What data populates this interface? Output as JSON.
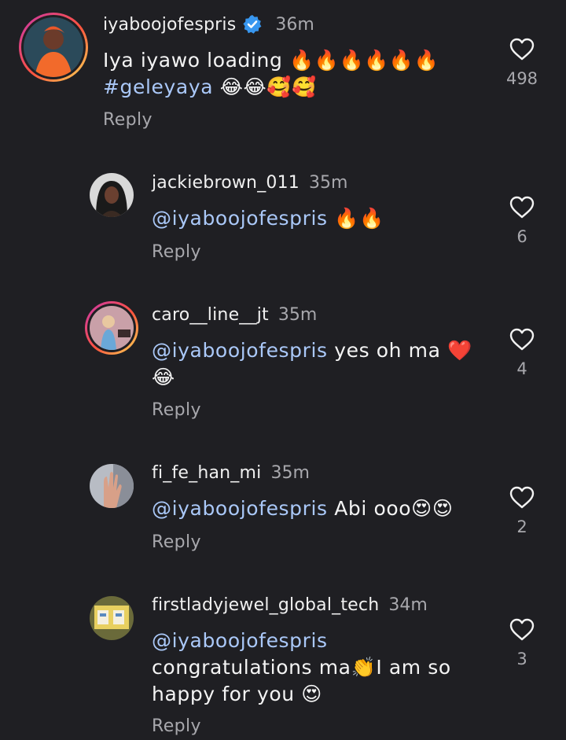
{
  "comments": [
    {
      "username": "iyaboojofespris",
      "verified": true,
      "time": "36m",
      "text_line1": "Iya iyawo loading 🔥🔥🔥🔥🔥🔥",
      "hashtag": "#geleyaya",
      "text_line2_emoji": "😂😂🥰🥰",
      "reply": "Reply",
      "likes": "498"
    },
    {
      "username": "jackiebrown_011",
      "time": "35m",
      "mention": "@iyaboojofespris",
      "text": " 🔥🔥",
      "reply": "Reply",
      "likes": "6"
    },
    {
      "username": "caro__line__jt",
      "time": "35m",
      "mention": "@iyaboojofespris",
      "text": " yes oh ma ❤️",
      "text_line2": "😂",
      "reply": "Reply",
      "likes": "4"
    },
    {
      "username": "fi_fe_han_mi",
      "time": "35m",
      "mention": "@iyaboojofespris",
      "text": " Abi ooo😍😍",
      "reply": "Reply",
      "likes": "2"
    },
    {
      "username": "firstladyjewel_global_tech",
      "time": "34m",
      "mention": "@iyaboojofespris",
      "text_line2": "congratulations ma👏I am so",
      "text_line3": "happy for you 😍",
      "reply": "Reply",
      "likes": "3"
    }
  ],
  "colors": {
    "background": "#1f1f23",
    "mention": "#aac8f8",
    "muted": "#a8a8ad",
    "verified": "#3897f0"
  },
  "icons": [
    "heart-outline-icon",
    "verified-badge-icon"
  ]
}
